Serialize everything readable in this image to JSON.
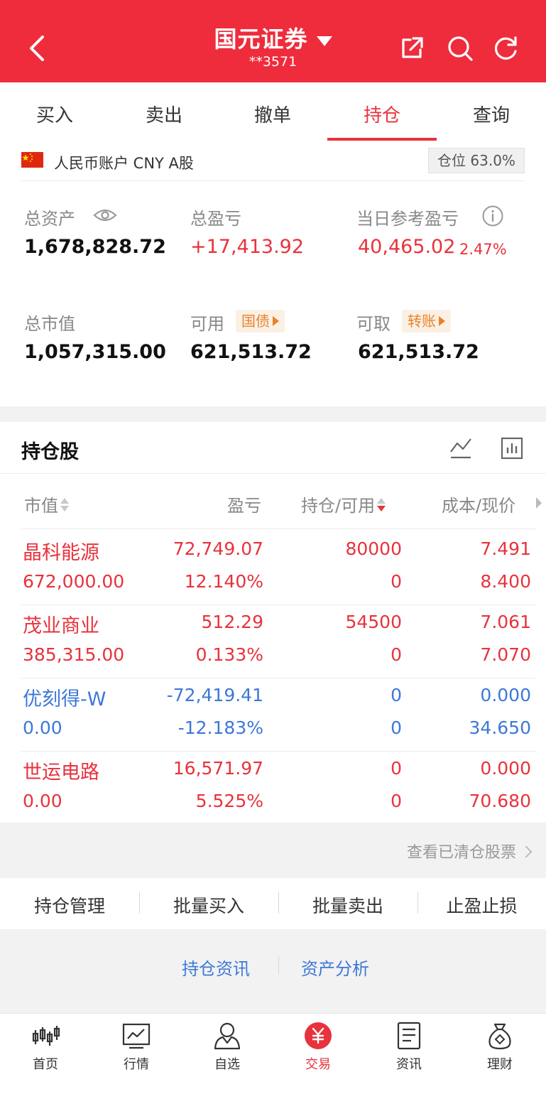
{
  "header": {
    "title": "国元证券",
    "account": "**3571"
  },
  "tabs": [
    {
      "label": "买入"
    },
    {
      "label": "卖出"
    },
    {
      "label": "撤单"
    },
    {
      "label": "持仓"
    },
    {
      "label": "查询"
    }
  ],
  "active_tab": "持仓",
  "account_bar": {
    "label": "人民币账户 CNY A股",
    "position": "仓位 63.0%"
  },
  "summary": {
    "total_assets_label": "总资产",
    "total_assets": "1,678,828.72",
    "total_pnl_label": "总盈亏",
    "total_pnl": "+17,413.92",
    "day_pnl_label": "当日参考盈亏",
    "day_pnl": "40,465.02",
    "day_pnl_pct": "2.47%",
    "market_value_label": "总市值",
    "market_value": "1,057,315.00",
    "available_label": "可用",
    "available": "621,513.72",
    "available_tag": "国债",
    "withdrawable_label": "可取",
    "withdrawable": "621,513.72",
    "withdrawable_tag": "转账"
  },
  "holdings": {
    "title": "持仓股",
    "columns": {
      "market_value": "市值",
      "pnl": "盈亏",
      "qty": "持仓/可用",
      "price": "成本/现价"
    },
    "rows": [
      {
        "name": "晶科能源",
        "mv": "672,000.00",
        "pnl": "72,749.07",
        "pnl_pct": "12.140%",
        "qty": "80000",
        "avail": "0",
        "cost": "7.491",
        "price": "8.400",
        "tone": "red"
      },
      {
        "name": "茂业商业",
        "mv": "385,315.00",
        "pnl": "512.29",
        "pnl_pct": "0.133%",
        "qty": "54500",
        "avail": "0",
        "cost": "7.061",
        "price": "7.070",
        "tone": "red"
      },
      {
        "name": "优刻得-W",
        "mv": "0.00",
        "pnl": "-72,419.41",
        "pnl_pct": "-12.183%",
        "qty": "0",
        "avail": "0",
        "cost": "0.000",
        "price": "34.650",
        "tone": "blue"
      },
      {
        "name": "世运电路",
        "mv": "0.00",
        "pnl": "16,571.97",
        "pnl_pct": "5.525%",
        "qty": "0",
        "avail": "0",
        "cost": "0.000",
        "price": "70.680",
        "tone": "red"
      }
    ]
  },
  "clear_link": "查看已清仓股票",
  "actions": [
    "持仓管理",
    "批量买入",
    "批量卖出",
    "止盈止损"
  ],
  "info_links": [
    "持仓资讯",
    "资产分析"
  ],
  "bottom_nav": [
    {
      "label": "首页",
      "icon": "candlestick-icon"
    },
    {
      "label": "行情",
      "icon": "chart-icon"
    },
    {
      "label": "自选",
      "icon": "user-icon"
    },
    {
      "label": "交易",
      "icon": "yuan-icon"
    },
    {
      "label": "资讯",
      "icon": "document-icon"
    },
    {
      "label": "理财",
      "icon": "money-bag-icon"
    }
  ],
  "nav_active": "交易",
  "colors": {
    "brand_red": "#ee2c3c",
    "gain": "#e8323c",
    "loss": "#3d78d8",
    "tag_orange": "#e8832c"
  }
}
